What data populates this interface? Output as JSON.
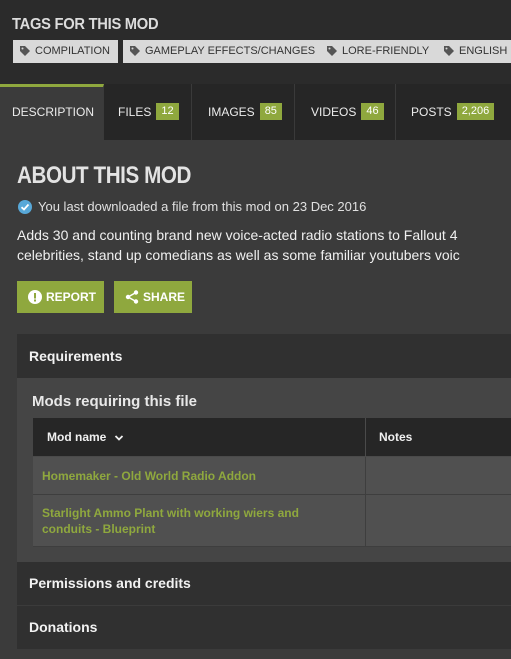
{
  "tags": {
    "title": "TAGS FOR THIS MOD",
    "items": [
      {
        "label": "COMPILATION",
        "icon": "tag-icon"
      },
      {
        "label": "GAMEPLAY EFFECTS/CHANGES",
        "icon": "tag-icon"
      },
      {
        "label": "LORE-FRIENDLY",
        "icon": "tag-icon"
      },
      {
        "label": "ENGLISH",
        "icon": "tag-icon"
      }
    ]
  },
  "tabs": [
    {
      "label": "DESCRIPTION",
      "count": "",
      "active": true
    },
    {
      "label": "FILES",
      "count": "12"
    },
    {
      "label": "IMAGES",
      "count": "85"
    },
    {
      "label": "VIDEOS",
      "count": "46"
    },
    {
      "label": "POSTS",
      "count": "2,206"
    }
  ],
  "about": {
    "title": "ABOUT THIS MOD",
    "downloaded_text": "You last downloaded a file from this mod on 23 Dec 2016",
    "description_line1": "Adds 30 and counting brand new voice-acted radio stations to Fallout 4",
    "description_line2": "celebrities, stand up comedians as well as some familiar youtubers voic"
  },
  "actions": {
    "report_label": "REPORT",
    "share_label": "SHARE"
  },
  "requirements": {
    "heading": "Requirements",
    "subheading": "Mods requiring this file",
    "col_name": "Mod name",
    "col_notes": "Notes",
    "rows": [
      {
        "name_line1": "Homemaker - Old World Radio Addon",
        "name_line2": ""
      },
      {
        "name_line1": "Starlight Ammo Plant with working wiers and",
        "name_line2": "conduits - Blueprint"
      }
    ]
  },
  "sections": {
    "permissions": "Permissions and credits",
    "donations": "Donations"
  },
  "colors": {
    "accent": "#8fa83e",
    "background": "#3b3b3b",
    "check": "#58a8d8"
  }
}
